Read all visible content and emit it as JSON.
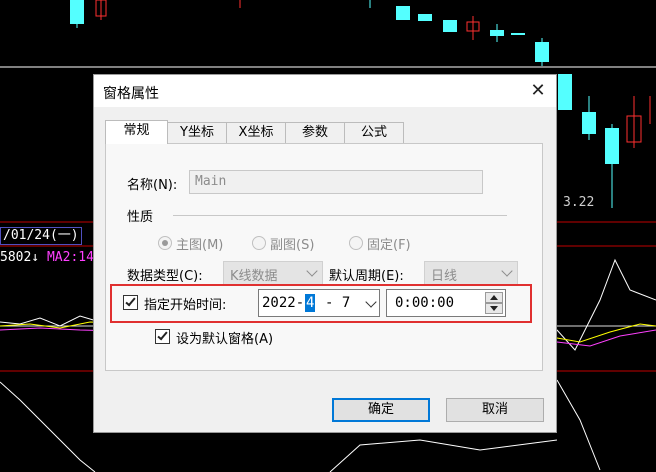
{
  "chart": {
    "date_label": "/01/24(一)",
    "ma_value": "5802↓",
    "ma2_label": "MA2:14",
    "price_label": "3.22",
    "colors": {
      "up": "#ff3030",
      "down": "#54ffff",
      "ma_white": "#ffffff",
      "ma_yellow": "#ffff00",
      "ma_magenta": "#ff40ff",
      "grid_red": "#c00000"
    }
  },
  "dialog": {
    "title": "窗格属性",
    "close_icon": "✕",
    "tabs": [
      {
        "label": "常规",
        "active": true
      },
      {
        "label": "Y坐标",
        "active": false
      },
      {
        "label": "X坐标",
        "active": false
      },
      {
        "label": "参数",
        "active": false
      },
      {
        "label": "公式",
        "active": false
      }
    ],
    "name_label": "名称(N):",
    "name_value": "Main",
    "nature_label": "性质",
    "radios": [
      {
        "label": "主图(M)",
        "selected": true
      },
      {
        "label": "副图(S)",
        "selected": false
      },
      {
        "label": "固定(F)",
        "selected": false
      }
    ],
    "data_type_label": "数据类型(C):",
    "data_type_value": "K线数据",
    "default_period_label": "默认周期(E):",
    "default_period_value": "日线",
    "start_time_label": "指定开始时间:",
    "start_time_checked": true,
    "date": {
      "year": "2022-",
      "month": " 4",
      "day": "- 7"
    },
    "time_value": "0:00:00",
    "default_pane_label": "设为默认窗格(A)",
    "default_pane_checked": true,
    "ok_label": "确定",
    "cancel_label": "取消"
  }
}
